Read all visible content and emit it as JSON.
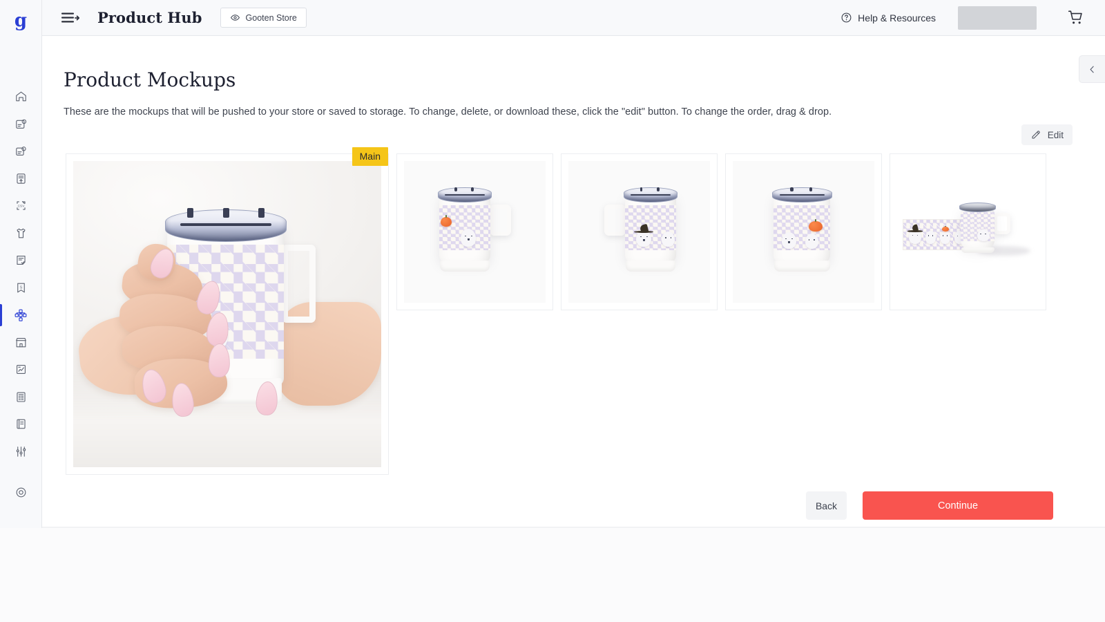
{
  "brand": {
    "logo_glyph": "g",
    "accent": "#2b3fd4"
  },
  "topbar": {
    "menu_icon": "hamburger-icon",
    "title": "Product Hub",
    "store_chip": {
      "icon": "eye-icon",
      "label": "Gooten Store"
    },
    "help": {
      "icon": "question-circle-icon",
      "label": "Help & Resources"
    },
    "account_placeholder": "",
    "cart_icon": "shopping-cart-icon"
  },
  "sidebar": {
    "items": [
      {
        "name": "sidebar-item-home",
        "icon": "home-icon",
        "active": false
      },
      {
        "name": "sidebar-item-new-order",
        "icon": "order-user-icon",
        "active": false
      },
      {
        "name": "sidebar-item-orders",
        "icon": "orders-user-icon",
        "active": false
      },
      {
        "name": "sidebar-item-upload-order",
        "icon": "file-upload-icon",
        "active": false
      },
      {
        "name": "sidebar-item-csv-export",
        "icon": "csv-export-icon",
        "active": false
      },
      {
        "name": "sidebar-item-products",
        "icon": "tshirt-icon",
        "active": false
      },
      {
        "name": "sidebar-item-approvals",
        "icon": "file-check-icon",
        "active": false
      },
      {
        "name": "sidebar-item-saved",
        "icon": "bookmark-s-icon",
        "active": false
      },
      {
        "name": "sidebar-item-product-hub",
        "icon": "hierarchy-icon",
        "active": true
      },
      {
        "name": "sidebar-item-storefront",
        "icon": "storefront-icon",
        "active": false
      },
      {
        "name": "sidebar-item-analytics",
        "icon": "chart-report-icon",
        "active": false
      },
      {
        "name": "sidebar-item-billing",
        "icon": "invoice-icon",
        "active": false
      },
      {
        "name": "sidebar-item-catalog",
        "icon": "book-icon",
        "active": false
      },
      {
        "name": "sidebar-item-settings",
        "icon": "sliders-icon",
        "active": false
      },
      {
        "name": "sidebar-item-support",
        "icon": "target-icon",
        "active": false
      }
    ]
  },
  "panel_toggle": {
    "icon": "chevron-left-icon"
  },
  "main": {
    "title": "Product Mockups",
    "description": "These are the mockups that will be pushed to your store or saved to storage. To change, delete, or download these, click the \"edit\" button. To change the order, drag & drop.",
    "edit_button": {
      "icon": "pencil-icon",
      "label": "Edit"
    },
    "main_badge": "Main",
    "mockups": [
      {
        "name": "mockup-main-lifestyle",
        "alt": "Hands holding white camp mug with lavender checkered pattern",
        "variant": "lifestyle"
      },
      {
        "name": "mockup-thumb-1",
        "alt": "Camp mug, handle right, checkered pattern with ghost and pumpkin",
        "variant": "handle-right"
      },
      {
        "name": "mockup-thumb-2",
        "alt": "Camp mug, handle left, checkered pattern with witch hat ghost",
        "variant": "handle-left"
      },
      {
        "name": "mockup-thumb-3",
        "alt": "Camp mug, back view, ghosts and pumpkin",
        "variant": "back"
      },
      {
        "name": "mockup-thumb-4",
        "alt": "Flat artwork wrap next to camp mug",
        "variant": "flat"
      }
    ]
  },
  "footer": {
    "back_label": "Back",
    "continue_label": "Continue",
    "continue_color": "#f9544f"
  }
}
